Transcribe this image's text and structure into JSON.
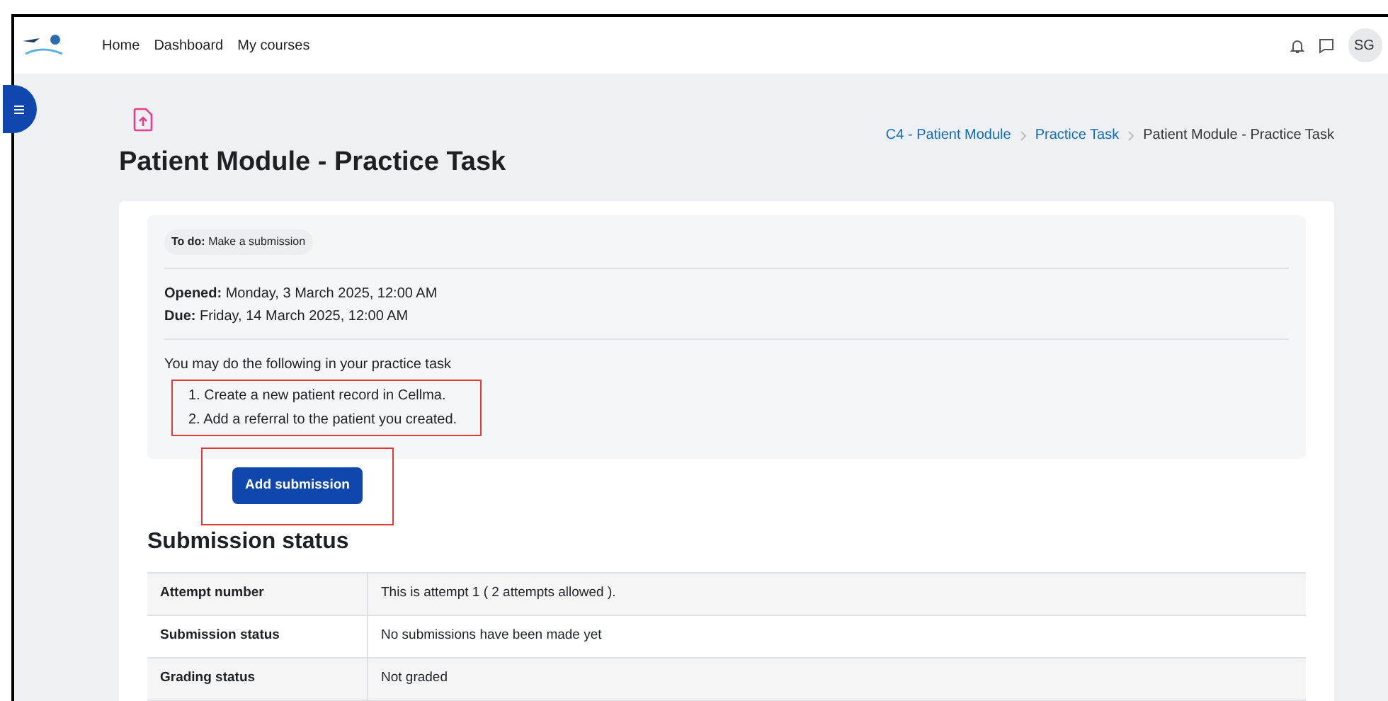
{
  "navbar": {
    "links": [
      "Home",
      "Dashboard",
      "My courses"
    ],
    "avatar": "SG"
  },
  "breadcrumb": [
    {
      "label": "C4 - Patient Module",
      "link": true
    },
    {
      "label": "Practice Task",
      "link": true
    },
    {
      "label": "Patient Module - Practice Task",
      "link": false
    }
  ],
  "page_title": "Patient Module - Practice Task",
  "activity": {
    "todo": "**To do:** Make a submission",
    "dates": [
      "**Opened:** Monday, 3 March 2025, 12:00 AM",
      "**Due:** Friday, 14 March 2025, 12:00 AM"
    ],
    "intro": "You may do the following in your practice task",
    "steps": [
      "1. Create a new patient record in Cellma.",
      "2. Add a referral to the patient you created."
    ]
  },
  "add_submission_button": "Add submission",
  "submission_status": {
    "heading": "Submission status",
    "rows": [
      {
        "label": "Attempt number",
        "value": "This is attempt 1 ( 2 attempts allowed )."
      },
      {
        "label": "Submission status",
        "value": "No submissions have been made yet"
      },
      {
        "label": "Grading status",
        "value": "Not graded"
      }
    ]
  }
}
